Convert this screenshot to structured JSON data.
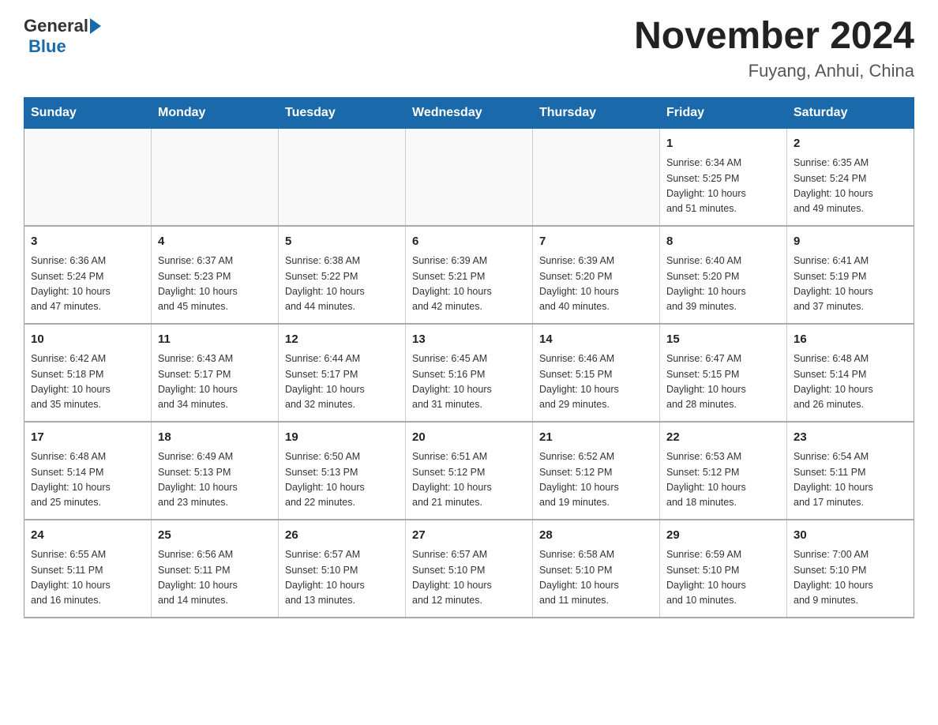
{
  "header": {
    "logo_general": "General",
    "logo_blue": "Blue",
    "title": "November 2024",
    "subtitle": "Fuyang, Anhui, China"
  },
  "weekdays": [
    "Sunday",
    "Monday",
    "Tuesday",
    "Wednesday",
    "Thursday",
    "Friday",
    "Saturday"
  ],
  "rows": [
    [
      {
        "day": "",
        "info": ""
      },
      {
        "day": "",
        "info": ""
      },
      {
        "day": "",
        "info": ""
      },
      {
        "day": "",
        "info": ""
      },
      {
        "day": "",
        "info": ""
      },
      {
        "day": "1",
        "info": "Sunrise: 6:34 AM\nSunset: 5:25 PM\nDaylight: 10 hours\nand 51 minutes."
      },
      {
        "day": "2",
        "info": "Sunrise: 6:35 AM\nSunset: 5:24 PM\nDaylight: 10 hours\nand 49 minutes."
      }
    ],
    [
      {
        "day": "3",
        "info": "Sunrise: 6:36 AM\nSunset: 5:24 PM\nDaylight: 10 hours\nand 47 minutes."
      },
      {
        "day": "4",
        "info": "Sunrise: 6:37 AM\nSunset: 5:23 PM\nDaylight: 10 hours\nand 45 minutes."
      },
      {
        "day": "5",
        "info": "Sunrise: 6:38 AM\nSunset: 5:22 PM\nDaylight: 10 hours\nand 44 minutes."
      },
      {
        "day": "6",
        "info": "Sunrise: 6:39 AM\nSunset: 5:21 PM\nDaylight: 10 hours\nand 42 minutes."
      },
      {
        "day": "7",
        "info": "Sunrise: 6:39 AM\nSunset: 5:20 PM\nDaylight: 10 hours\nand 40 minutes."
      },
      {
        "day": "8",
        "info": "Sunrise: 6:40 AM\nSunset: 5:20 PM\nDaylight: 10 hours\nand 39 minutes."
      },
      {
        "day": "9",
        "info": "Sunrise: 6:41 AM\nSunset: 5:19 PM\nDaylight: 10 hours\nand 37 minutes."
      }
    ],
    [
      {
        "day": "10",
        "info": "Sunrise: 6:42 AM\nSunset: 5:18 PM\nDaylight: 10 hours\nand 35 minutes."
      },
      {
        "day": "11",
        "info": "Sunrise: 6:43 AM\nSunset: 5:17 PM\nDaylight: 10 hours\nand 34 minutes."
      },
      {
        "day": "12",
        "info": "Sunrise: 6:44 AM\nSunset: 5:17 PM\nDaylight: 10 hours\nand 32 minutes."
      },
      {
        "day": "13",
        "info": "Sunrise: 6:45 AM\nSunset: 5:16 PM\nDaylight: 10 hours\nand 31 minutes."
      },
      {
        "day": "14",
        "info": "Sunrise: 6:46 AM\nSunset: 5:15 PM\nDaylight: 10 hours\nand 29 minutes."
      },
      {
        "day": "15",
        "info": "Sunrise: 6:47 AM\nSunset: 5:15 PM\nDaylight: 10 hours\nand 28 minutes."
      },
      {
        "day": "16",
        "info": "Sunrise: 6:48 AM\nSunset: 5:14 PM\nDaylight: 10 hours\nand 26 minutes."
      }
    ],
    [
      {
        "day": "17",
        "info": "Sunrise: 6:48 AM\nSunset: 5:14 PM\nDaylight: 10 hours\nand 25 minutes."
      },
      {
        "day": "18",
        "info": "Sunrise: 6:49 AM\nSunset: 5:13 PM\nDaylight: 10 hours\nand 23 minutes."
      },
      {
        "day": "19",
        "info": "Sunrise: 6:50 AM\nSunset: 5:13 PM\nDaylight: 10 hours\nand 22 minutes."
      },
      {
        "day": "20",
        "info": "Sunrise: 6:51 AM\nSunset: 5:12 PM\nDaylight: 10 hours\nand 21 minutes."
      },
      {
        "day": "21",
        "info": "Sunrise: 6:52 AM\nSunset: 5:12 PM\nDaylight: 10 hours\nand 19 minutes."
      },
      {
        "day": "22",
        "info": "Sunrise: 6:53 AM\nSunset: 5:12 PM\nDaylight: 10 hours\nand 18 minutes."
      },
      {
        "day": "23",
        "info": "Sunrise: 6:54 AM\nSunset: 5:11 PM\nDaylight: 10 hours\nand 17 minutes."
      }
    ],
    [
      {
        "day": "24",
        "info": "Sunrise: 6:55 AM\nSunset: 5:11 PM\nDaylight: 10 hours\nand 16 minutes."
      },
      {
        "day": "25",
        "info": "Sunrise: 6:56 AM\nSunset: 5:11 PM\nDaylight: 10 hours\nand 14 minutes."
      },
      {
        "day": "26",
        "info": "Sunrise: 6:57 AM\nSunset: 5:10 PM\nDaylight: 10 hours\nand 13 minutes."
      },
      {
        "day": "27",
        "info": "Sunrise: 6:57 AM\nSunset: 5:10 PM\nDaylight: 10 hours\nand 12 minutes."
      },
      {
        "day": "28",
        "info": "Sunrise: 6:58 AM\nSunset: 5:10 PM\nDaylight: 10 hours\nand 11 minutes."
      },
      {
        "day": "29",
        "info": "Sunrise: 6:59 AM\nSunset: 5:10 PM\nDaylight: 10 hours\nand 10 minutes."
      },
      {
        "day": "30",
        "info": "Sunrise: 7:00 AM\nSunset: 5:10 PM\nDaylight: 10 hours\nand 9 minutes."
      }
    ]
  ]
}
